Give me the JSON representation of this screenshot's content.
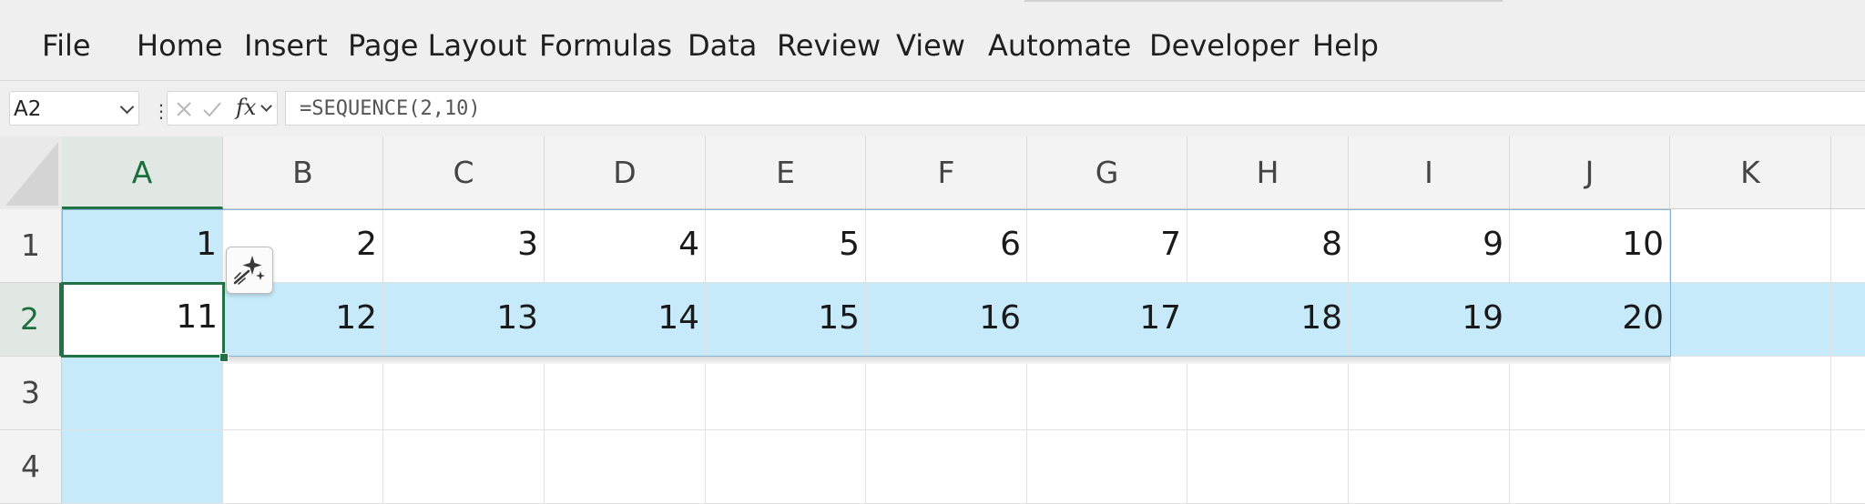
{
  "ribbon": {
    "tabs": [
      "File",
      "Home",
      "Insert",
      "Page Layout",
      "Formulas",
      "Data",
      "Review",
      "View",
      "Automate",
      "Developer",
      "Help"
    ]
  },
  "formula_bar": {
    "name_box": "A2",
    "formula": "=SEQUENCE(2,10)",
    "fx_label": "fx"
  },
  "sheet": {
    "columns": [
      "A",
      "B",
      "C",
      "D",
      "E",
      "F",
      "G",
      "H",
      "I",
      "J",
      "K"
    ],
    "rows": [
      "1",
      "2",
      "3",
      "4"
    ],
    "selected_column": "A",
    "selected_row": "2",
    "active_cell": "A2",
    "cells": {
      "r1": [
        "1",
        "2",
        "3",
        "4",
        "5",
        "6",
        "7",
        "8",
        "9",
        "10"
      ],
      "r2": [
        "11",
        "12",
        "13",
        "14",
        "15",
        "16",
        "17",
        "18",
        "19",
        "20"
      ]
    }
  },
  "colors": {
    "selection_green": "#217346",
    "highlight_blue": "#c6eaf9"
  },
  "icons": [
    "chevron-down-icon",
    "more-options-icon",
    "cancel-icon",
    "enter-icon",
    "fx-icon",
    "quick-analysis-icon"
  ]
}
